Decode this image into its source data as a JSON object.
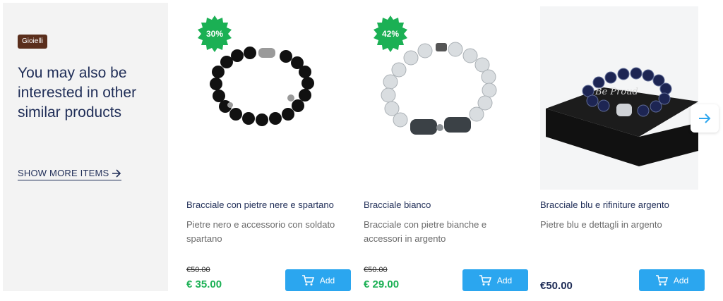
{
  "side": {
    "category": "Gioielli",
    "heading": "You may also be interested in other similar products",
    "show_more": "SHOW MORE ITEMS"
  },
  "products": [
    {
      "badge": "30%",
      "title": "Bracciale con pietre nere e spartano",
      "desc": "Pietre nero e accessorio con soldato spartano",
      "old_price": "€50.00",
      "price": "€ 35.00",
      "add_label": "Add"
    },
    {
      "badge": "42%",
      "title": "Bracciale bianco",
      "desc": "Bracciale con pietre bianche e accessori in argento",
      "old_price": "€50.00",
      "price": "€ 29.00",
      "add_label": "Add"
    },
    {
      "title": "Bracciale blu e rifiniture argento",
      "desc": "Pietre blu e dettagli in argento",
      "price": "€50.00",
      "add_label": "Add"
    }
  ],
  "colors": {
    "accent": "#2ba6ef",
    "discount": "#1bb054",
    "heading": "#1f2d57",
    "badge_bg": "#5a2e1c"
  },
  "icons": {
    "cart": "cart-icon",
    "arrow_right": "arrow-right-icon",
    "next": "chevron-right-icon"
  }
}
